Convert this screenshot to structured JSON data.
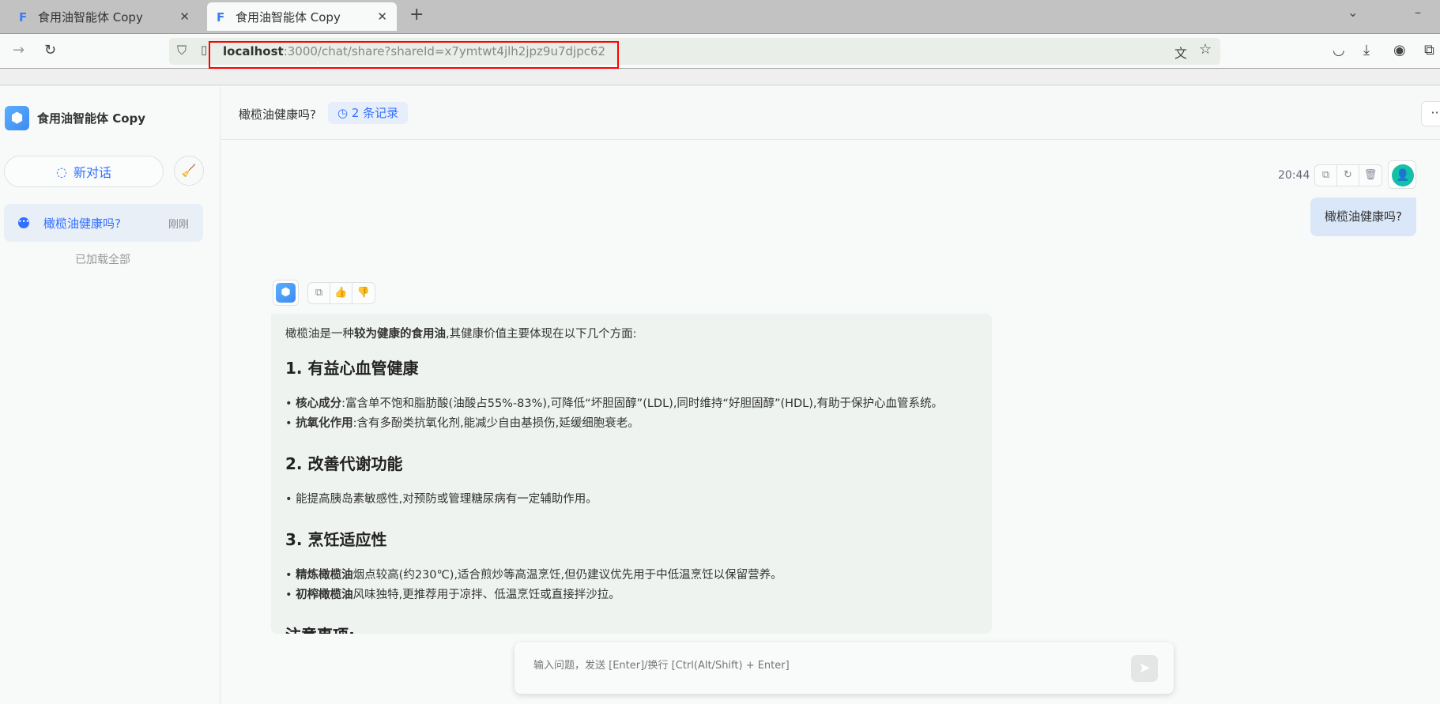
{
  "browser": {
    "tabs": [
      {
        "title": "食用油智能体 Copy"
      },
      {
        "title": "食用油智能体 Copy"
      }
    ],
    "new_tab": "+",
    "url_host": "localhost",
    "url_rest": ":3000/chat/share?shareId=x7ymtwt4jlh2jpz9u7djpc62"
  },
  "sidebar": {
    "app_name": "食用油智能体 Copy",
    "new_chat": "新对话",
    "history": [
      {
        "title": "橄榄油健康吗?",
        "time": "刚刚"
      }
    ],
    "loaded_all": "已加载全部"
  },
  "header": {
    "title": "橄榄油健康吗?",
    "records": "2 条记录",
    "more": "···"
  },
  "chat": {
    "user": {
      "time": "20:44",
      "text": "橄榄油健康吗?"
    },
    "bot": {
      "intro_pre": "橄榄油是一种",
      "intro_bold": "较为健康的食用油",
      "intro_post": ",其健康价值主要体现在以下几个方面:",
      "s1": "1. 有益心血管健康",
      "s1_items": [
        {
          "b": "核心成分",
          "t": ":富含单不饱和脂肪酸(油酸占55%-83%),可降低“坏胆固醇”(LDL),同时维持“好胆固醇”(HDL),有助于保护心血管系统。"
        },
        {
          "b": "抗氧化作用",
          "t": ":含有多酚类抗氧化剂,能减少自由基损伤,延缓细胞衰老。"
        }
      ],
      "s2": "2. 改善代谢功能",
      "s2_items": [
        "能提高胰岛素敏感性,对预防或管理糖尿病有一定辅助作用。"
      ],
      "s3": "3. 烹饪适应性",
      "s3_items": [
        {
          "b": "精炼橄榄油",
          "t": "烟点较高(约230℃),适合煎炒等高温烹饪,但仍建议优先用于中低温烹饪以保留营养。"
        },
        {
          "b": "初榨橄榄油",
          "t": "风味独特,更推荐用于凉拌、低温烹饪或直接拌沙拉。"
        }
      ],
      "s4": "注意事项:"
    }
  },
  "input": {
    "placeholder": "输入问题，发送 [Enter]/换行 [Ctrl(Alt/Shift) + Enter]"
  }
}
